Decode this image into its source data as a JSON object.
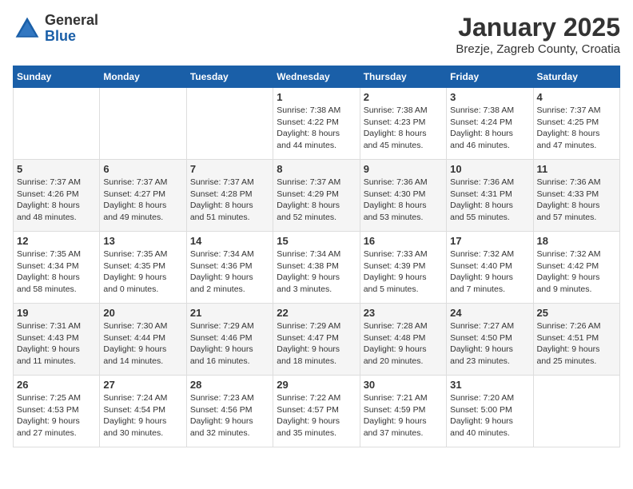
{
  "logo": {
    "general": "General",
    "blue": "Blue"
  },
  "title": "January 2025",
  "location": "Brezje, Zagreb County, Croatia",
  "weekdays": [
    "Sunday",
    "Monday",
    "Tuesday",
    "Wednesday",
    "Thursday",
    "Friday",
    "Saturday"
  ],
  "weeks": [
    [
      {
        "day": "",
        "info": ""
      },
      {
        "day": "",
        "info": ""
      },
      {
        "day": "",
        "info": ""
      },
      {
        "day": "1",
        "info": "Sunrise: 7:38 AM\nSunset: 4:22 PM\nDaylight: 8 hours\nand 44 minutes."
      },
      {
        "day": "2",
        "info": "Sunrise: 7:38 AM\nSunset: 4:23 PM\nDaylight: 8 hours\nand 45 minutes."
      },
      {
        "day": "3",
        "info": "Sunrise: 7:38 AM\nSunset: 4:24 PM\nDaylight: 8 hours\nand 46 minutes."
      },
      {
        "day": "4",
        "info": "Sunrise: 7:37 AM\nSunset: 4:25 PM\nDaylight: 8 hours\nand 47 minutes."
      }
    ],
    [
      {
        "day": "5",
        "info": "Sunrise: 7:37 AM\nSunset: 4:26 PM\nDaylight: 8 hours\nand 48 minutes."
      },
      {
        "day": "6",
        "info": "Sunrise: 7:37 AM\nSunset: 4:27 PM\nDaylight: 8 hours\nand 49 minutes."
      },
      {
        "day": "7",
        "info": "Sunrise: 7:37 AM\nSunset: 4:28 PM\nDaylight: 8 hours\nand 51 minutes."
      },
      {
        "day": "8",
        "info": "Sunrise: 7:37 AM\nSunset: 4:29 PM\nDaylight: 8 hours\nand 52 minutes."
      },
      {
        "day": "9",
        "info": "Sunrise: 7:36 AM\nSunset: 4:30 PM\nDaylight: 8 hours\nand 53 minutes."
      },
      {
        "day": "10",
        "info": "Sunrise: 7:36 AM\nSunset: 4:31 PM\nDaylight: 8 hours\nand 55 minutes."
      },
      {
        "day": "11",
        "info": "Sunrise: 7:36 AM\nSunset: 4:33 PM\nDaylight: 8 hours\nand 57 minutes."
      }
    ],
    [
      {
        "day": "12",
        "info": "Sunrise: 7:35 AM\nSunset: 4:34 PM\nDaylight: 8 hours\nand 58 minutes."
      },
      {
        "day": "13",
        "info": "Sunrise: 7:35 AM\nSunset: 4:35 PM\nDaylight: 9 hours\nand 0 minutes."
      },
      {
        "day": "14",
        "info": "Sunrise: 7:34 AM\nSunset: 4:36 PM\nDaylight: 9 hours\nand 2 minutes."
      },
      {
        "day": "15",
        "info": "Sunrise: 7:34 AM\nSunset: 4:38 PM\nDaylight: 9 hours\nand 3 minutes."
      },
      {
        "day": "16",
        "info": "Sunrise: 7:33 AM\nSunset: 4:39 PM\nDaylight: 9 hours\nand 5 minutes."
      },
      {
        "day": "17",
        "info": "Sunrise: 7:32 AM\nSunset: 4:40 PM\nDaylight: 9 hours\nand 7 minutes."
      },
      {
        "day": "18",
        "info": "Sunrise: 7:32 AM\nSunset: 4:42 PM\nDaylight: 9 hours\nand 9 minutes."
      }
    ],
    [
      {
        "day": "19",
        "info": "Sunrise: 7:31 AM\nSunset: 4:43 PM\nDaylight: 9 hours\nand 11 minutes."
      },
      {
        "day": "20",
        "info": "Sunrise: 7:30 AM\nSunset: 4:44 PM\nDaylight: 9 hours\nand 14 minutes."
      },
      {
        "day": "21",
        "info": "Sunrise: 7:29 AM\nSunset: 4:46 PM\nDaylight: 9 hours\nand 16 minutes."
      },
      {
        "day": "22",
        "info": "Sunrise: 7:29 AM\nSunset: 4:47 PM\nDaylight: 9 hours\nand 18 minutes."
      },
      {
        "day": "23",
        "info": "Sunrise: 7:28 AM\nSunset: 4:48 PM\nDaylight: 9 hours\nand 20 minutes."
      },
      {
        "day": "24",
        "info": "Sunrise: 7:27 AM\nSunset: 4:50 PM\nDaylight: 9 hours\nand 23 minutes."
      },
      {
        "day": "25",
        "info": "Sunrise: 7:26 AM\nSunset: 4:51 PM\nDaylight: 9 hours\nand 25 minutes."
      }
    ],
    [
      {
        "day": "26",
        "info": "Sunrise: 7:25 AM\nSunset: 4:53 PM\nDaylight: 9 hours\nand 27 minutes."
      },
      {
        "day": "27",
        "info": "Sunrise: 7:24 AM\nSunset: 4:54 PM\nDaylight: 9 hours\nand 30 minutes."
      },
      {
        "day": "28",
        "info": "Sunrise: 7:23 AM\nSunset: 4:56 PM\nDaylight: 9 hours\nand 32 minutes."
      },
      {
        "day": "29",
        "info": "Sunrise: 7:22 AM\nSunset: 4:57 PM\nDaylight: 9 hours\nand 35 minutes."
      },
      {
        "day": "30",
        "info": "Sunrise: 7:21 AM\nSunset: 4:59 PM\nDaylight: 9 hours\nand 37 minutes."
      },
      {
        "day": "31",
        "info": "Sunrise: 7:20 AM\nSunset: 5:00 PM\nDaylight: 9 hours\nand 40 minutes."
      },
      {
        "day": "",
        "info": ""
      }
    ]
  ]
}
